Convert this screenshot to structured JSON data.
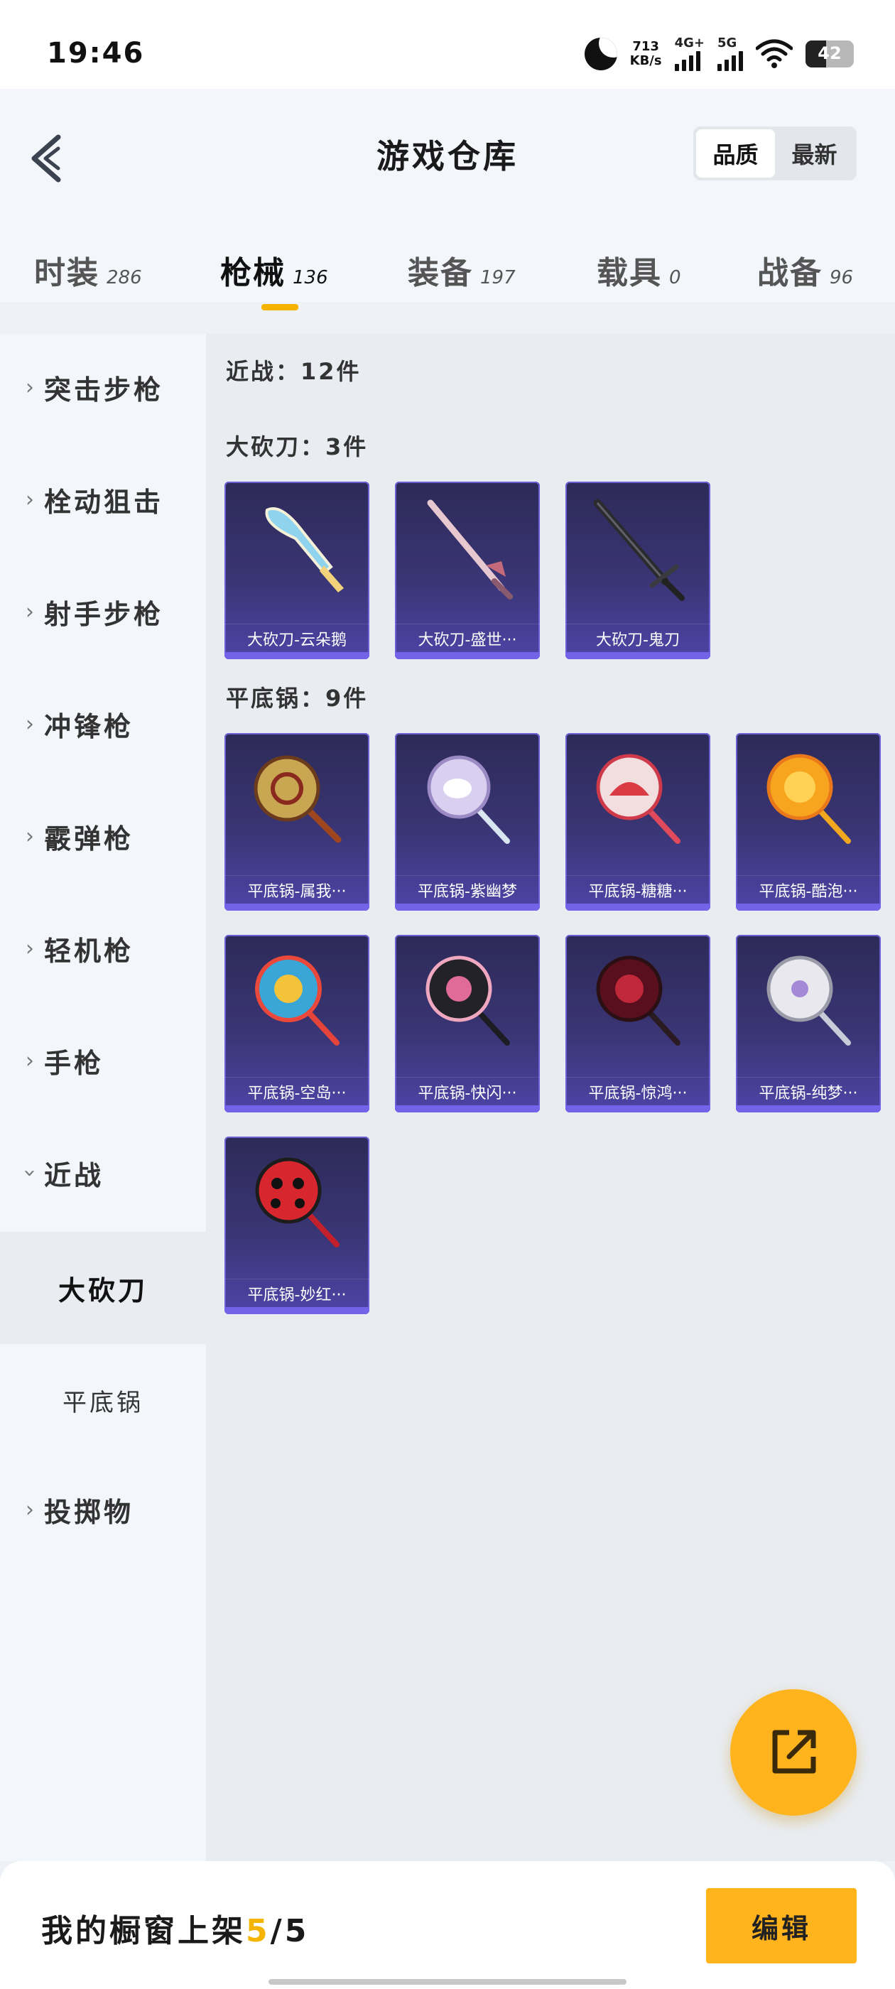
{
  "status": {
    "time": "19:46",
    "net_speed_value": "713",
    "net_speed_unit": "KB/s",
    "sig1": "4G+",
    "sig2": "5G",
    "battery": "42",
    "battery_level": 0.42
  },
  "header": {
    "title": "游戏仓库",
    "sort_options": [
      "品质",
      "最新"
    ],
    "sort_active": "品质"
  },
  "tabs": [
    {
      "name": "时装",
      "count": "286"
    },
    {
      "name": "枪械",
      "count": "136"
    },
    {
      "name": "装备",
      "count": "197"
    },
    {
      "name": "载具",
      "count": "0"
    },
    {
      "name": "战备",
      "count": "96"
    }
  ],
  "active_tab": "枪械",
  "sidebar": {
    "items": [
      "突击步枪",
      "栓动狙击",
      "射手步枪",
      "冲锋枪",
      "霰弹枪",
      "轻机枪",
      "手枪",
      "近战"
    ],
    "expanded": "近战",
    "subitems": [
      "大砍刀",
      "平底锅"
    ],
    "active_sub": "大砍刀",
    "last": "投掷物"
  },
  "content": {
    "group_title": "近战：12件",
    "sections": [
      {
        "title": "大砍刀：3件",
        "items": [
          "大砍刀-云朵鹅",
          "大砍刀-盛世···",
          "大砍刀-鬼刀"
        ]
      },
      {
        "title": "平底锅：9件",
        "items": [
          "平底锅-属我···",
          "平底锅-紫幽梦",
          "平底锅-糖糖···",
          "平底锅-酷泡···",
          "平底锅-空岛···",
          "平底锅-快闪···",
          "平底锅-惊鸿···",
          "平底锅-纯梦···",
          "平底锅-妙红···"
        ]
      }
    ]
  },
  "bottom": {
    "showcase_label": "我的橱窗上架",
    "showcase_used": "5",
    "showcase_total": "/5",
    "edit_label": "编辑"
  },
  "colors": {
    "accent": "#ffb31c",
    "card_bg": "#3a3574",
    "card_border": "#6b5fd6"
  }
}
